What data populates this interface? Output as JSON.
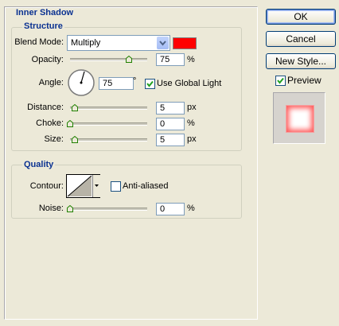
{
  "panel": {
    "title": "Inner Shadow"
  },
  "structure": {
    "legend": "Structure",
    "blend_mode": {
      "label": "Blend Mode:",
      "value": "Multiply",
      "shadow_color": "#ff0000"
    },
    "opacity": {
      "label": "Opacity:",
      "value": "75",
      "unit": "%",
      "slider": 0.75
    },
    "angle": {
      "label": "Angle:",
      "value": "75",
      "unit": "°",
      "use_global_light": {
        "label": "Use Global Light",
        "checked": true
      }
    },
    "distance": {
      "label": "Distance:",
      "value": "5",
      "unit": "px",
      "slider": 0.02
    },
    "choke": {
      "label": "Choke:",
      "value": "0",
      "unit": "%",
      "slider": 0.0
    },
    "size": {
      "label": "Size:",
      "value": "5",
      "unit": "px",
      "slider": 0.02
    }
  },
  "quality": {
    "legend": "Quality",
    "contour": {
      "label": "Contour:",
      "anti_aliased": {
        "label": "Anti-aliased",
        "checked": false
      }
    },
    "noise": {
      "label": "Noise:",
      "value": "0",
      "unit": "%",
      "slider": 0.0
    }
  },
  "buttons": {
    "ok": "OK",
    "cancel": "Cancel",
    "new_style": "New Style..."
  },
  "preview": {
    "label": "Preview",
    "checked": true
  }
}
